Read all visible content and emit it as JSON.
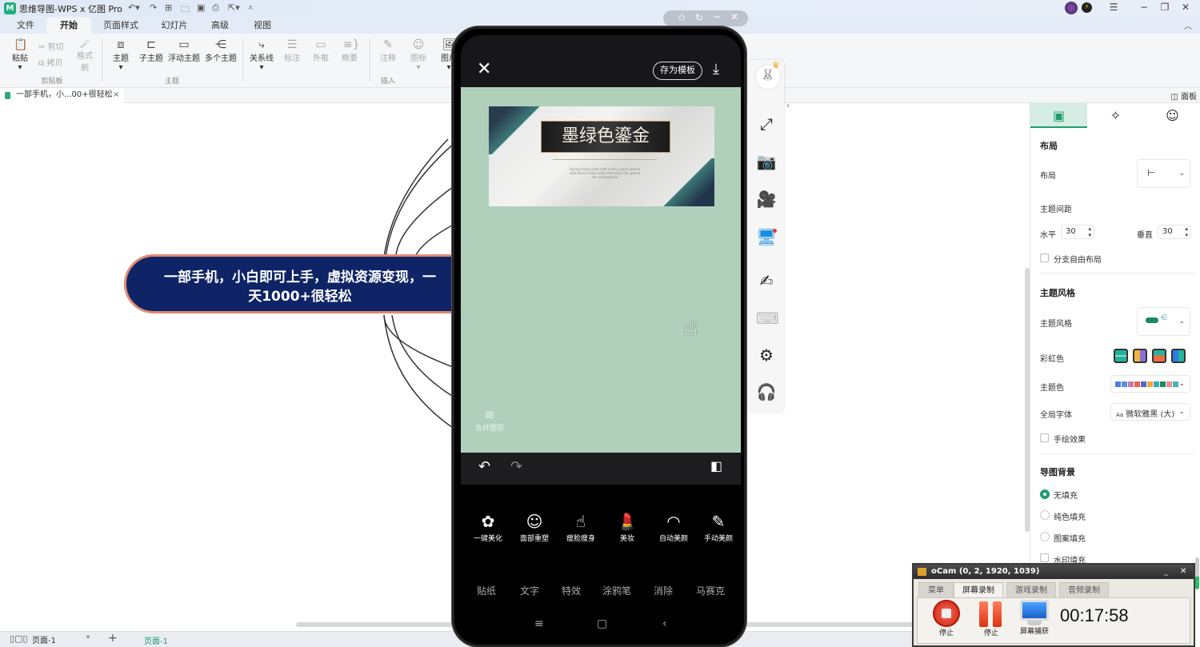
{
  "titlebar": {
    "logo": "M",
    "title": "思维导图-WPS x 亿图 Pro",
    "quick_actions": [
      "undo-icon",
      "redo-icon",
      "new-icon",
      "open-icon",
      "save-icon",
      "print-icon",
      "export-icon",
      "more-icon"
    ],
    "window_controls": {
      "menu": "☰",
      "minimize": "−",
      "restore": "❐",
      "close": "✕"
    }
  },
  "menu_tabs": [
    "文件",
    "开始",
    "页面样式",
    "幻灯片",
    "高级",
    "视图"
  ],
  "active_menu_tab": "开始",
  "ribbon": {
    "clipboard": {
      "paste": "粘贴",
      "cut": "剪切",
      "copy": "拷贝",
      "format_painter": "格式刷",
      "group": "剪贴板"
    },
    "topic": {
      "items": [
        "主题",
        "子主题",
        "浮动主题",
        "多个主题"
      ],
      "group": "主题"
    },
    "insert": {
      "items": [
        "关系线",
        "标注",
        "外框",
        "概要",
        "注释",
        "图标",
        "图片"
      ],
      "group": "插入"
    }
  },
  "doc_tab": {
    "title": "一部手机，小...00+很轻松",
    "close": "×"
  },
  "panel_toggle": "面板",
  "mindmap": {
    "root_line1": "一部手机，小白即可上手，虚拟资源变现，一",
    "root_line2": "天1000+很轻松"
  },
  "status": {
    "page_select": "页面-1",
    "add": "+",
    "page_tab": "页面-1"
  },
  "mini_controls": [
    "pin-icon",
    "rotate-icon",
    "minimize-icon",
    "close-icon"
  ],
  "phone": {
    "save_template": "存为模板",
    "template_title": "墨绿色鎏金",
    "template_sub": "Spring lovely color with lovely sound poems with Kimchi blue colors Romantic life spread the atmosphere",
    "merge_layers": "合并图层",
    "tools": [
      {
        "icon": "✿",
        "label": "一键美化"
      },
      {
        "icon": "☺",
        "label": "面部重塑"
      },
      {
        "icon": "☝",
        "label": "瘦脸瘦身"
      },
      {
        "icon": "💄",
        "label": "美妆"
      },
      {
        "icon": "◠",
        "label": "自动美颜"
      },
      {
        "icon": "✎",
        "label": "手动美颜"
      }
    ],
    "tabs": [
      "贴纸",
      "文字",
      "特效",
      "涂鸦笔",
      "消除",
      "马赛克"
    ],
    "nav": {
      "menu": "≡",
      "home": "▢",
      "back": "‹"
    }
  },
  "side_tools": [
    "mascot-icon",
    "fullscreen-icon",
    "camera-icon",
    "video-record-icon",
    "screen-share-icon",
    "brush-icon",
    "keyboard-icon",
    "settings-icon",
    "headset-icon"
  ],
  "right_panel": {
    "tabs": [
      "layout-tab",
      "ai-tab",
      "icon-tab"
    ],
    "layout_heading": "布局",
    "layout_label": "布局",
    "spacing_label": "主题间距",
    "horizontal_label": "水平",
    "horizontal_value": "30",
    "vertical_label": "垂直",
    "vertical_value": "30",
    "free_layout": "分支自由布局",
    "style_heading": "主题风格",
    "style_label": "主题风格",
    "rainbow_label": "彩虹色",
    "theme_color_label": "主题色",
    "theme_colors": [
      "#4e7ed9",
      "#5a8ee6",
      "#c879b0",
      "#e9644f",
      "#5466c9",
      "#f1a93b",
      "#3fa7c4",
      "#1a8a5a",
      "#ef8d8d",
      "#44b3b3"
    ],
    "font_label": "全局字体",
    "font_value": "微软雅黑 (大)",
    "font_prefix": "Aa",
    "hand_drawn": "手绘效果",
    "bg_heading": "导图背景",
    "bg_options": [
      "无填充",
      "纯色填充",
      "图案填充"
    ],
    "bg_selected": "无填充",
    "watermark": "水印填充"
  },
  "ocam": {
    "title": "oCam (0, 2, 1920, 1039)",
    "tabs": [
      "菜单",
      "屏幕录制",
      "游戏录制",
      "音频录制"
    ],
    "active_tab": "屏幕录制",
    "buttons": [
      "停止",
      "停止",
      "屏幕捕获"
    ],
    "timer": "00:17:58"
  }
}
